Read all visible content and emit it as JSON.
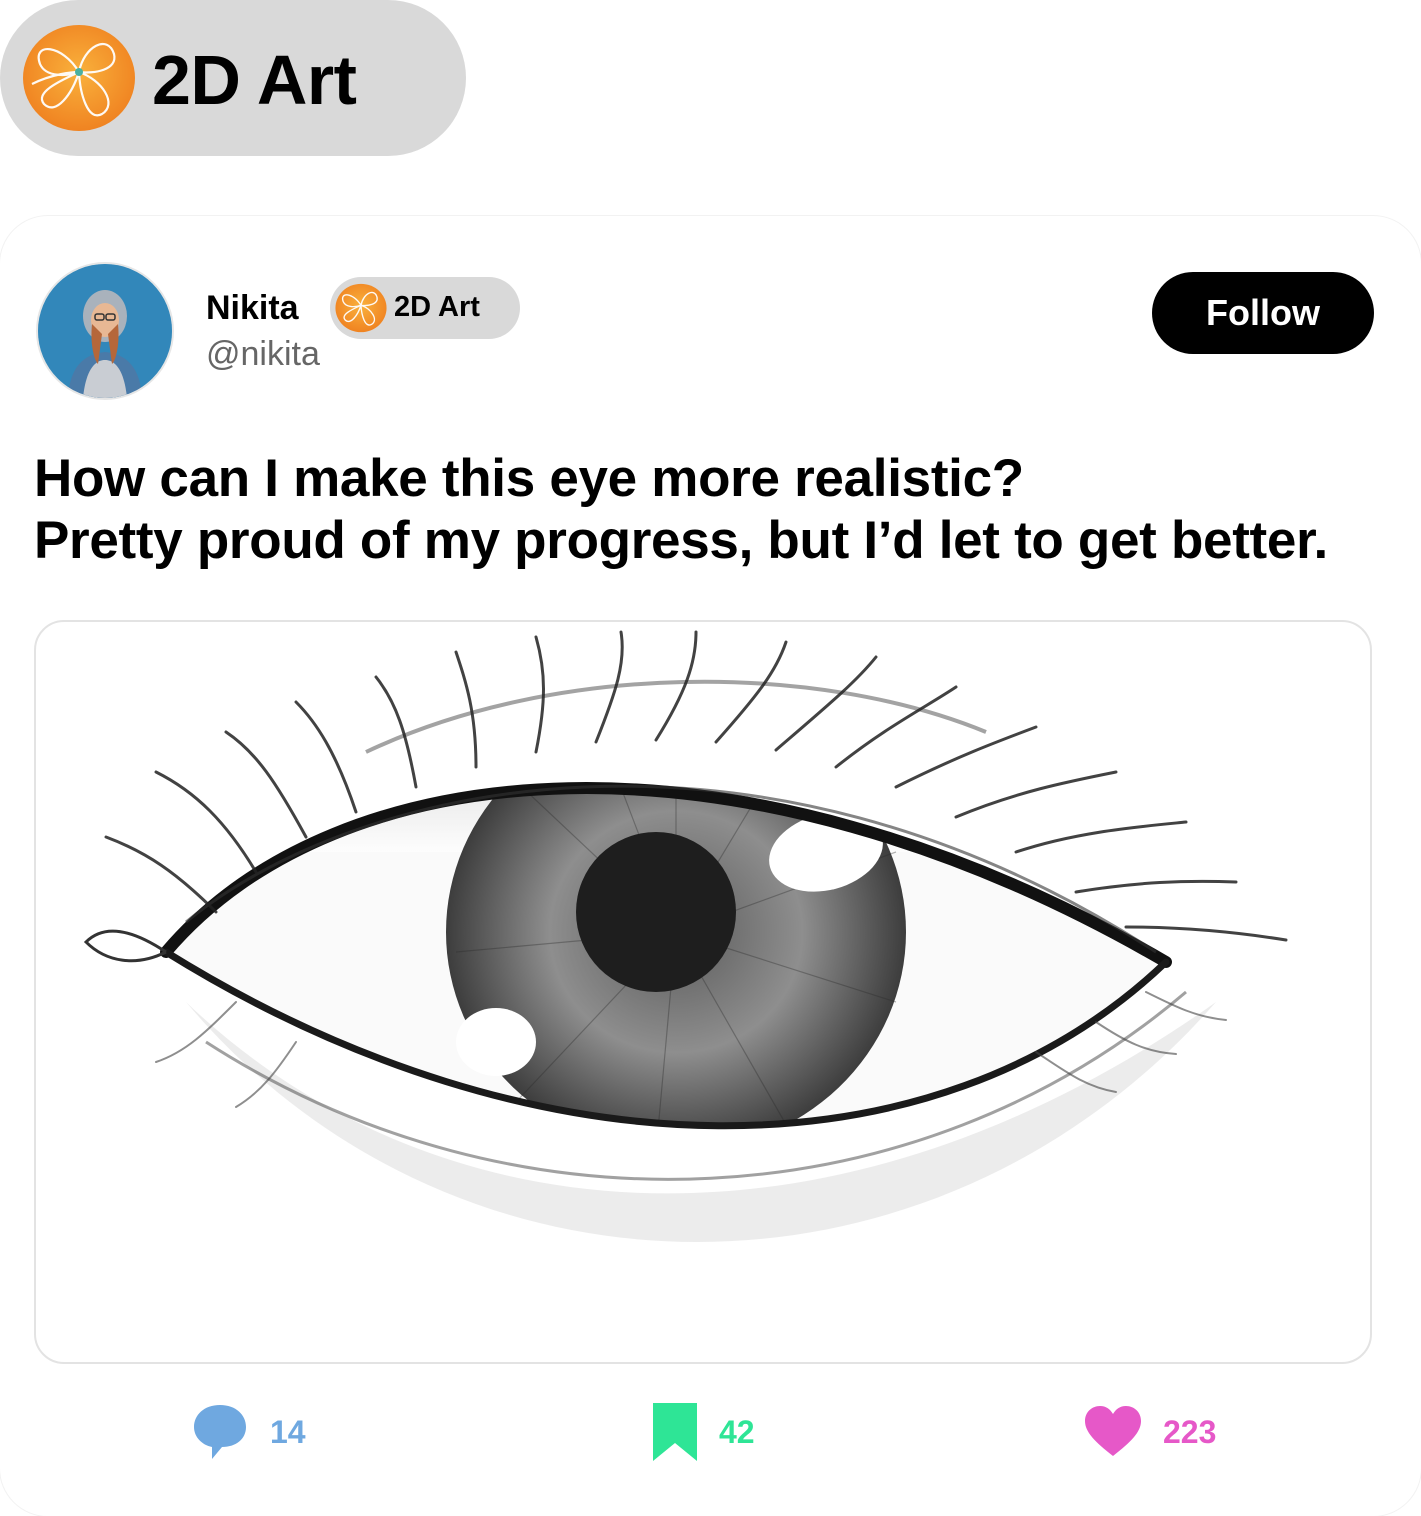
{
  "community": {
    "name": "2D Art",
    "logo_icon": "orange-flower-logo-icon"
  },
  "post": {
    "author": {
      "name": "Nikita",
      "handle": "@nikita",
      "avatar_icon": "avatar-photo"
    },
    "tag": {
      "label": "2D Art"
    },
    "follow_label": "Follow",
    "text_lines": [
      "How can I make this eye more realistic?",
      "Pretty proud of my progress, but I’d let to get better."
    ],
    "image": "pencil-drawing-of-eye",
    "actions": {
      "comments": {
        "count": "14",
        "icon": "comment-bubble-icon",
        "color": "#6fa8e0"
      },
      "saves": {
        "count": "42",
        "icon": "bookmark-icon",
        "color": "#2ee596"
      },
      "likes": {
        "count": "223",
        "icon": "heart-icon",
        "color": "#e658c8"
      }
    }
  }
}
